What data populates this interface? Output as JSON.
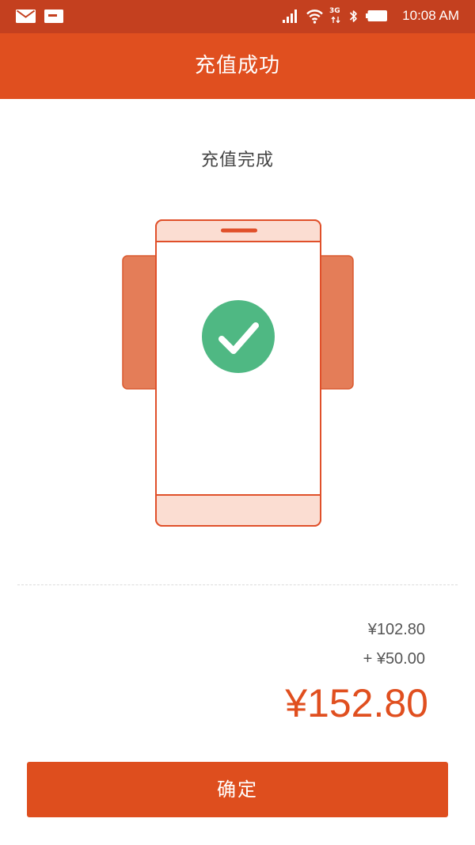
{
  "status_bar": {
    "time": "10:08 AM",
    "network_label": "3G",
    "left_icons": [
      "mail-icon",
      "notification-card-icon"
    ],
    "right_icons": [
      "signal-icon",
      "wifi-icon",
      "mobile-data-icon",
      "bluetooth-icon",
      "battery-icon"
    ]
  },
  "header": {
    "title": "充值成功"
  },
  "main": {
    "status_text": "充值完成",
    "illustration_icons": [
      "phone-illustration",
      "check-circle-icon"
    ]
  },
  "summary": {
    "previous_balance": "¥102.80",
    "added_amount": "+ ¥50.00",
    "total_balance": "¥152.80"
  },
  "actions": {
    "confirm_label": "确定"
  },
  "colors": {
    "status_bar": "#C4401F",
    "header": "#E04F1F",
    "accent": "#E04F1F",
    "button": "#DE4E1E",
    "success": "#4FB883",
    "illustration_card": "#E47D58",
    "illustration_bezel": "#FBDDD2",
    "text_primary": "#444444",
    "text_secondary": "#555555"
  }
}
